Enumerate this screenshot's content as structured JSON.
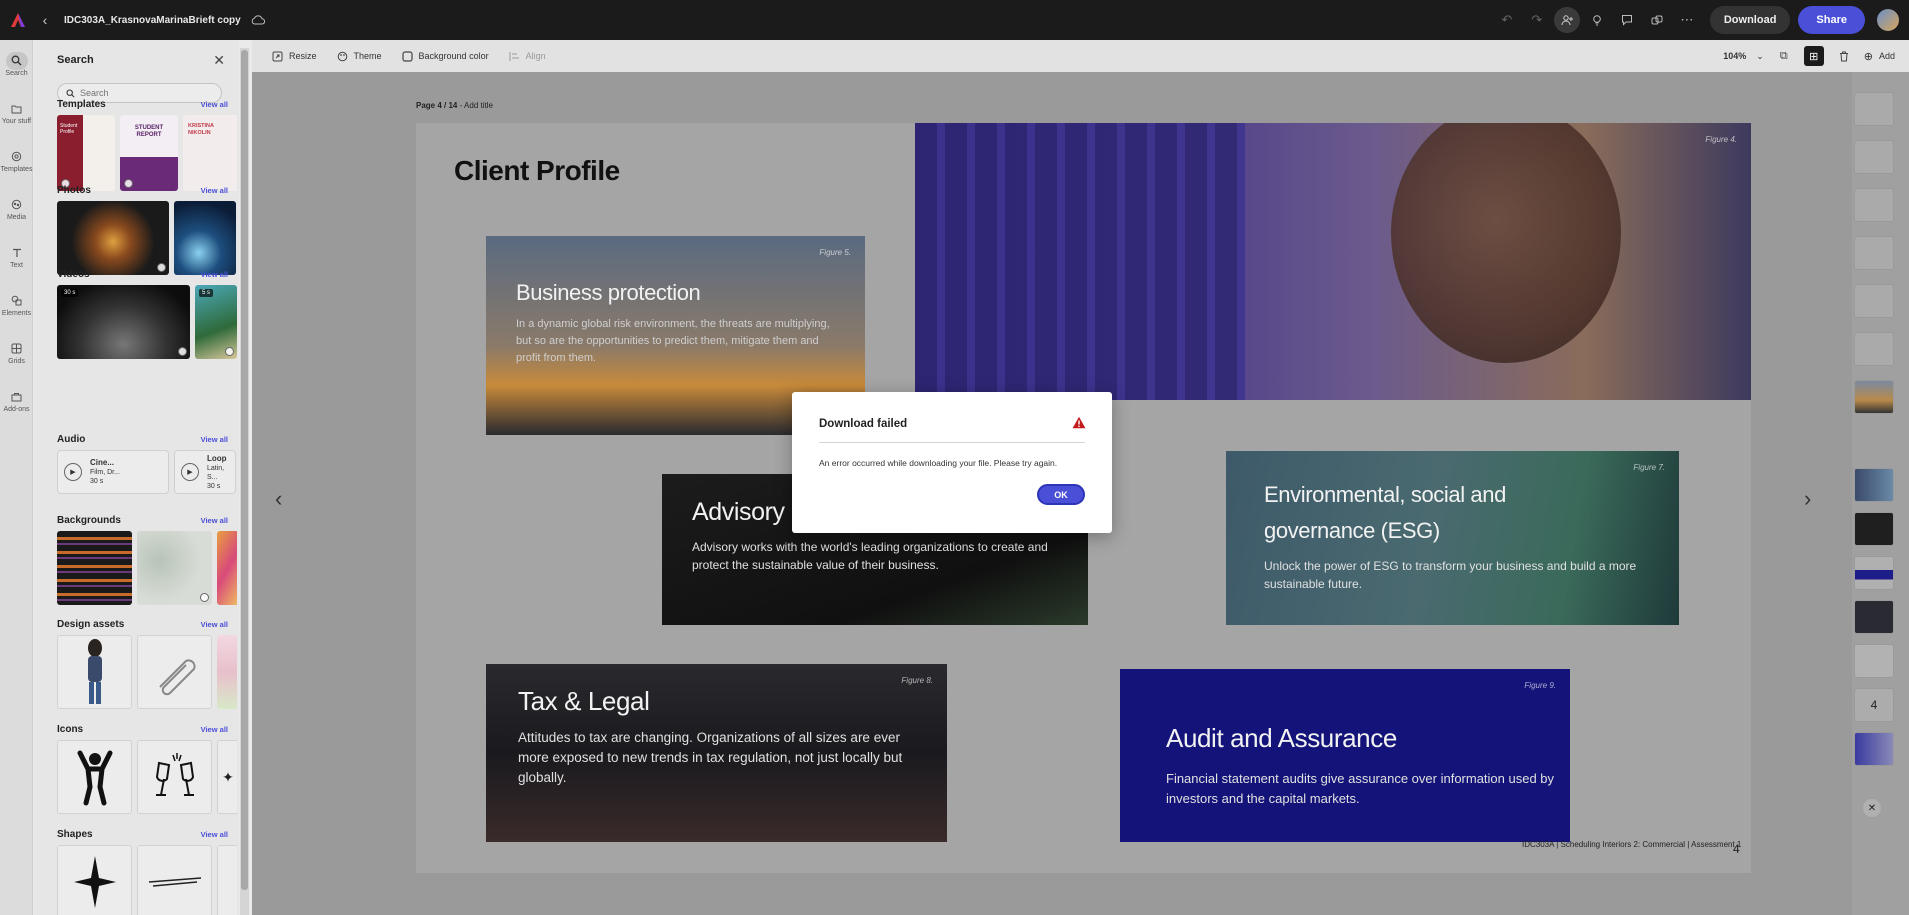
{
  "topbar": {
    "doc_title": "IDC303A_KrasnovaMarinaBrieft copy",
    "download_label": "Download",
    "share_label": "Share"
  },
  "rail": [
    {
      "label": "Search",
      "icon": "search-icon"
    },
    {
      "label": "Your stuff",
      "icon": "folder-icon"
    },
    {
      "label": "Templates",
      "icon": "templates-icon"
    },
    {
      "label": "Media",
      "icon": "media-icon"
    },
    {
      "label": "Text",
      "icon": "text-icon"
    },
    {
      "label": "Elements",
      "icon": "elements-icon"
    },
    {
      "label": "Grids",
      "icon": "grids-icon"
    },
    {
      "label": "Add-ons",
      "icon": "addons-icon"
    }
  ],
  "panel": {
    "title": "Search",
    "search_placeholder": "Search",
    "view_all": "View all",
    "sections": {
      "templates": "Templates",
      "photos": "Photos",
      "videos": "Videos",
      "audio": "Audio",
      "backgrounds": "Backgrounds",
      "design_assets": "Design assets",
      "icons": "Icons",
      "shapes": "Shapes"
    },
    "template_thumbs": [
      {
        "text": "Student Profile"
      },
      {
        "text": "STUDENT REPORT"
      },
      {
        "text": "KRISTINA NIKOLIN"
      }
    ],
    "video_tags": [
      "30 s",
      "5 s"
    ],
    "audio": [
      {
        "title": "Cine...",
        "sub": "Film, Dr...",
        "dur": "30 s"
      },
      {
        "title": "Loop",
        "sub": "Latin, S...",
        "dur": "30 s"
      }
    ]
  },
  "toolbar2": {
    "resize": "Resize",
    "theme": "Theme",
    "background_color": "Background color",
    "align": "Align",
    "zoom": "104%",
    "add": "Add"
  },
  "canvas": {
    "page_label_bold": "Page 4 / 14",
    "page_label_rest": " - Add title"
  },
  "slide": {
    "title": "Client Profile",
    "hero_fig": "Figure 4.",
    "cards": {
      "business": {
        "fig": "Figure 5.",
        "title": "Business protection",
        "text": "In a dynamic global risk environment, the threats are multiplying, but so are the opportunities to predict them, mitigate them and profit from them."
      },
      "advisory": {
        "title": "Advisory",
        "text": "Advisory works with the world's leading organizations to create and protect the sustainable value of their business."
      },
      "esg": {
        "fig": "Figure 7.",
        "title": "Environmental, social and governance (ESG)",
        "text": "Unlock the power of ESG to transform your business and build a more sustainable future."
      },
      "tax": {
        "fig": "Figure 8.",
        "title": "Tax & Legal",
        "text": "Attitudes to tax are changing. Organizations of all sizes are ever more exposed to new trends in tax regulation, not just locally but globally."
      },
      "audit": {
        "fig": "Figure 9.",
        "title": "Audit and Assurance",
        "text": "Financial statement audits give assurance over information used by investors and the capital markets."
      }
    },
    "footer": "IDC303A | Scheduling Interiors 2: Commercial | Assessment 1",
    "page_number": "4"
  },
  "thumbnails": {
    "current_number": "4"
  },
  "dialog": {
    "title": "Download failed",
    "message": "An error occurred while downloading your file. Please try again.",
    "ok_label": "OK"
  },
  "colors": {
    "accent": "#4a4fd8",
    "warning": "#c21b1b"
  }
}
